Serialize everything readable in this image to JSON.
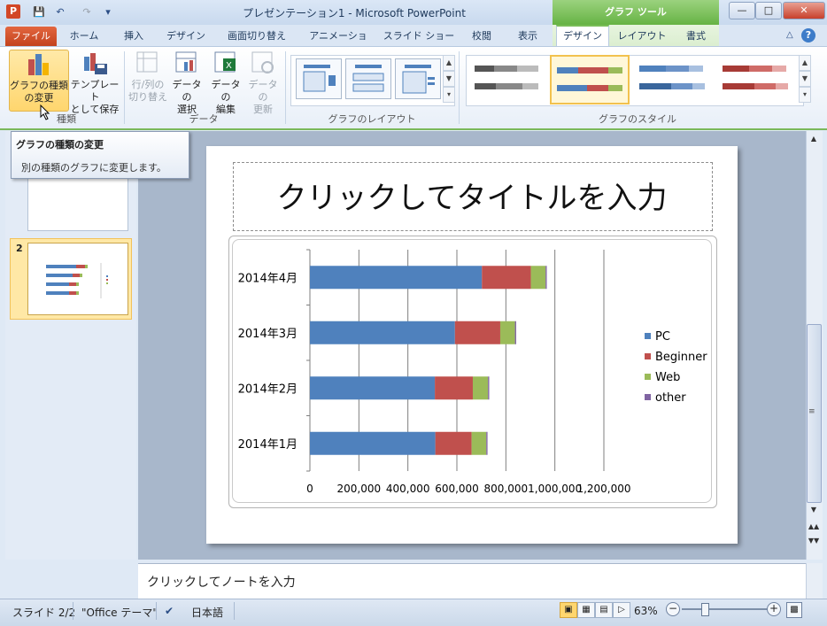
{
  "titlebar": {
    "app_icon": "P",
    "title": "プレゼンテーション1 - Microsoft PowerPoint",
    "chart_tools": "グラフ ツール",
    "quick_access": [
      "save-icon",
      "undo-icon",
      "redo-icon",
      "customize-icon"
    ]
  },
  "tabs": {
    "file": "ファイル",
    "items": [
      "ホーム",
      "挿入",
      "デザイン",
      "画面切り替え",
      "アニメーション",
      "スライド ショー",
      "校閲",
      "表示"
    ],
    "chart_tabs": [
      "デザイン",
      "レイアウト",
      "書式"
    ]
  },
  "ribbon": {
    "type_group": {
      "label": "種類",
      "change_type": [
        "グラフの種類",
        "の変更"
      ],
      "save_template": [
        "テンプレート",
        "として保存"
      ]
    },
    "data_group": {
      "label": "データ",
      "switch_row_col": [
        "行/列の",
        "切り替え"
      ],
      "select_data": [
        "データの",
        "選択"
      ],
      "edit_data": [
        "データの",
        "編集"
      ],
      "refresh_data": [
        "データの",
        "更新"
      ]
    },
    "layout_group": {
      "label": "グラフのレイアウト"
    },
    "style_group": {
      "label": "グラフのスタイル"
    },
    "colors": {
      "blue": "#4f81bd",
      "red": "#c0504d",
      "green": "#9bbb59",
      "purple": "#8064a2",
      "chart_tools_green": "#79bd57"
    }
  },
  "tooltip": {
    "title": "グラフの種類の変更",
    "desc": "別の種類のグラフに変更します。"
  },
  "slides_pane": {
    "slide2_number": "2"
  },
  "slide": {
    "title": "クリックしてタイトルを入力"
  },
  "chart_data": {
    "type": "bar",
    "stacked": true,
    "orientation": "horizontal",
    "categories": [
      "2014年1月",
      "2014年2月",
      "2014年3月",
      "2014年4月"
    ],
    "series": [
      {
        "name": "PC",
        "color": "#4f81bd",
        "values": [
          512000,
          510000,
          592000,
          702000
        ]
      },
      {
        "name": "Beginner",
        "color": "#c0504d",
        "values": [
          148000,
          155000,
          185000,
          200000
        ]
      },
      {
        "name": "Web",
        "color": "#9bbb59",
        "values": [
          60000,
          62000,
          60000,
          60000
        ]
      },
      {
        "name": "other",
        "color": "#8064a2",
        "values": [
          5000,
          5000,
          5000,
          5000
        ]
      }
    ],
    "xlim": [
      0,
      1200000
    ],
    "ticks": [
      "0",
      "200,000",
      "400,000",
      "600,000",
      "800,000",
      "1,000,000",
      "1,200,000"
    ],
    "grid": true,
    "legend": "right"
  },
  "notes": {
    "placeholder": "クリックしてノートを入力"
  },
  "status": {
    "slide_info": "スライド 2/2",
    "theme": "\"Office テーマ\"",
    "language": "日本語",
    "zoom": "63%"
  }
}
